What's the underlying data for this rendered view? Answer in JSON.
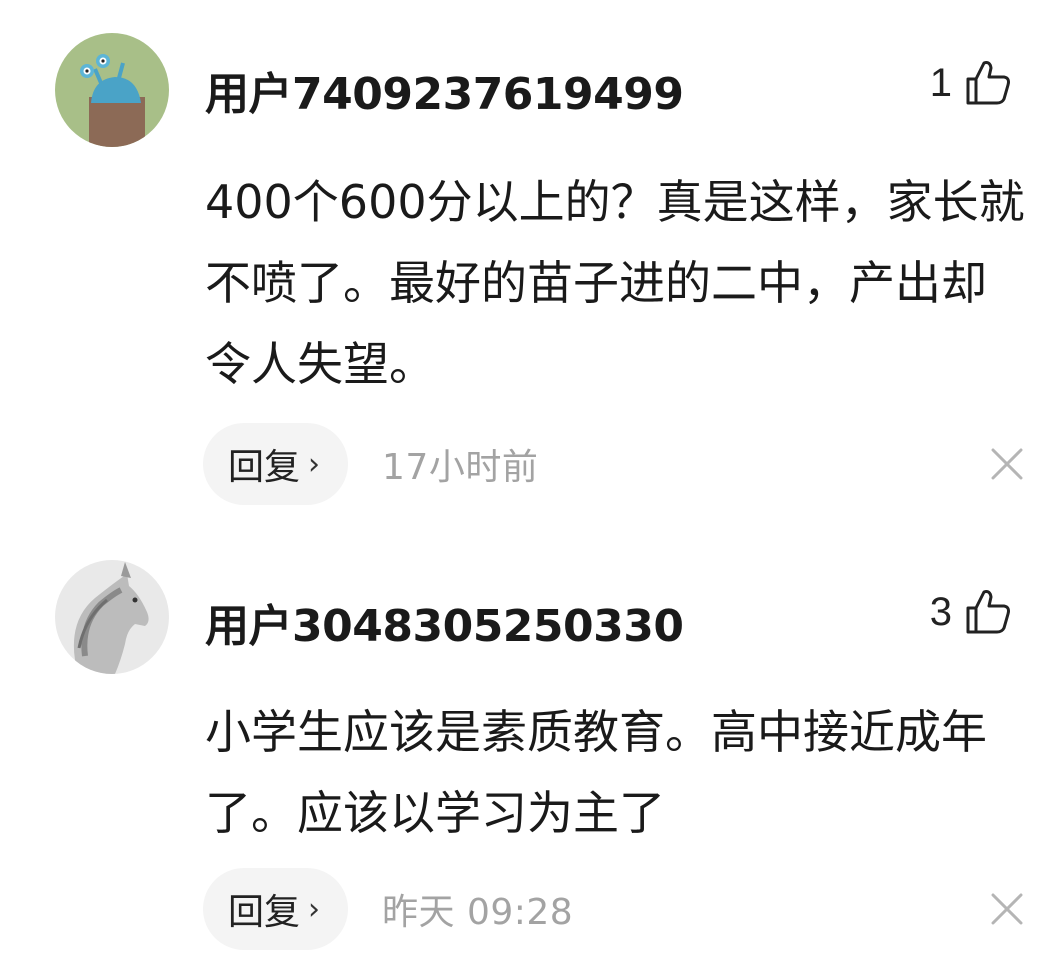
{
  "comments": [
    {
      "username": "用户7409237619499",
      "likes": "1",
      "content": "400个600分以上的？真是这样，家长就不喷了。最好的苗子进的二中，产出却令人失望。",
      "reply_label": "回复",
      "reply_chevron": "›",
      "timestamp": "17小时前",
      "avatar_icon": "cartoon-avatar",
      "avatar_bg": "#a8bf88"
    },
    {
      "username": "用户3048305250330",
      "likes": "3",
      "content": "小学生应该是素质教育。高中接近成年了。应该以学习为主了",
      "reply_label": "回复",
      "reply_chevron": "›",
      "timestamp": "昨天  09:28",
      "avatar_icon": "horse-avatar",
      "avatar_bg": "#e6e6e6"
    }
  ],
  "colors": {
    "text": "#1a1a1a",
    "muted": "#a3a3a3",
    "pill_bg": "#f4f4f4"
  }
}
